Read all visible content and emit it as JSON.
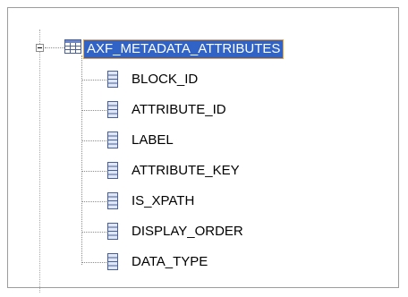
{
  "tree": {
    "root": {
      "label": "AXF_METADATA_ATTRIBUTES",
      "icon": "table-icon",
      "expanded": true,
      "selected": true
    },
    "columns": [
      {
        "label": "BLOCK_ID",
        "icon": "column-icon"
      },
      {
        "label": "ATTRIBUTE_ID",
        "icon": "column-icon"
      },
      {
        "label": "LABEL",
        "icon": "column-icon"
      },
      {
        "label": "ATTRIBUTE_KEY",
        "icon": "column-icon"
      },
      {
        "label": "IS_XPATH",
        "icon": "column-icon"
      },
      {
        "label": "DISPLAY_ORDER",
        "icon": "column-icon"
      },
      {
        "label": "DATA_TYPE",
        "icon": "column-icon"
      }
    ]
  },
  "colors": {
    "selection_bg": "#3163c6",
    "selection_border": "#f2a43a",
    "column_icon": "#5a6fa8"
  }
}
